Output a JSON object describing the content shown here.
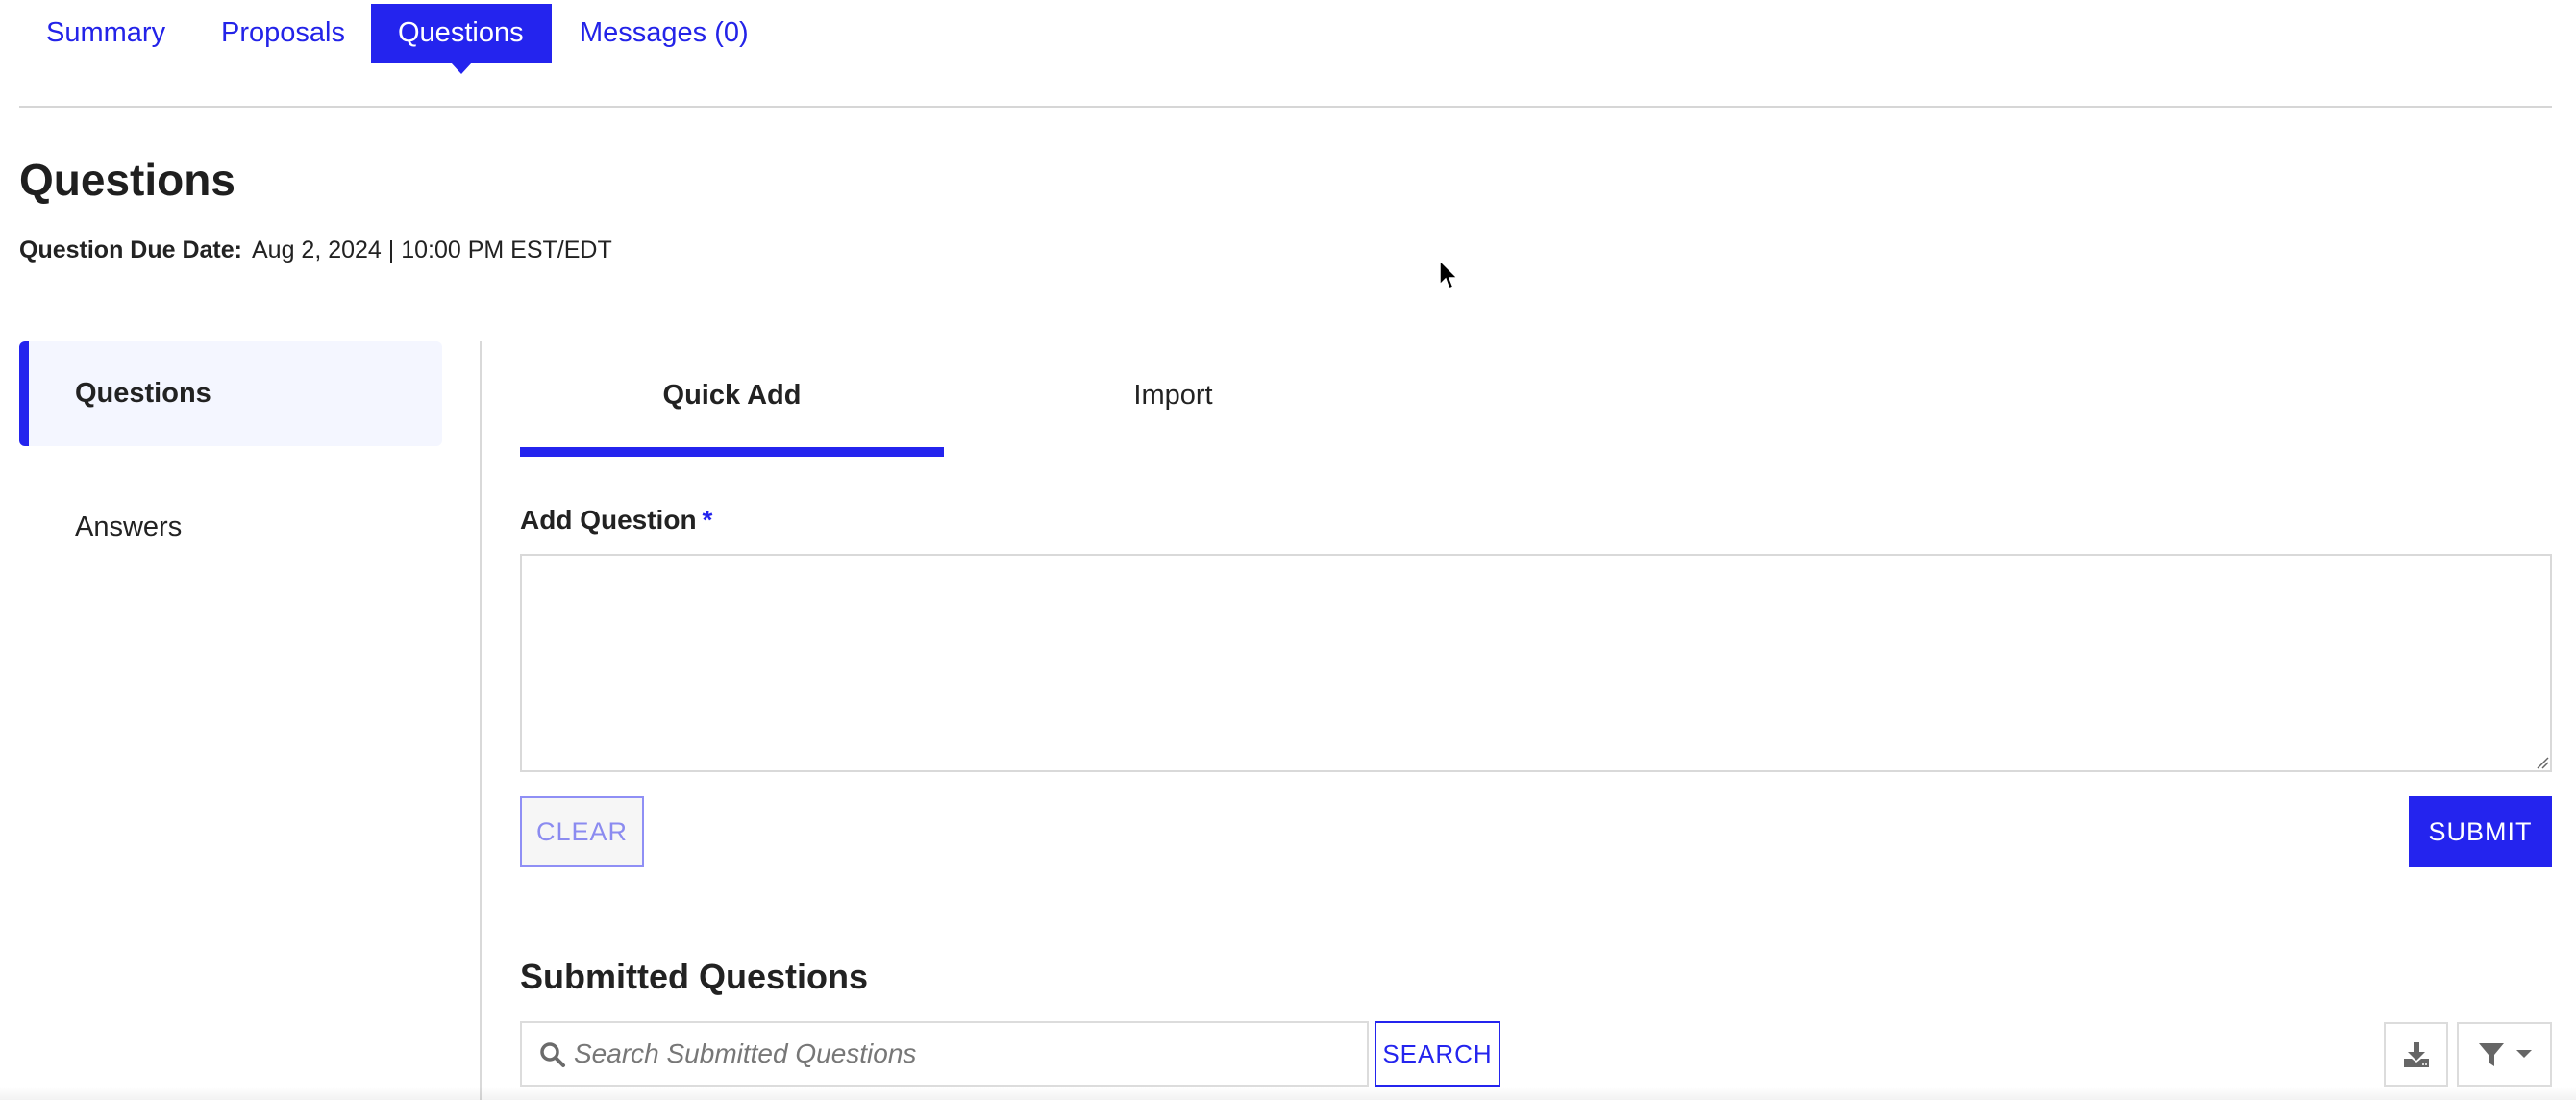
{
  "top_tabs": [
    {
      "label": "Summary",
      "active": false
    },
    {
      "label": "Proposals",
      "active": false
    },
    {
      "label": "Questions",
      "active": true
    },
    {
      "label": "Messages (0)",
      "active": false
    }
  ],
  "page": {
    "title": "Questions",
    "due_date_label": "Question Due Date:",
    "due_date_value": "Aug 2, 2024 | 10:00 PM EST/EDT"
  },
  "sidebar": {
    "items": [
      {
        "label": "Questions",
        "active": true
      },
      {
        "label": "Answers",
        "active": false
      }
    ]
  },
  "sub_tabs": [
    {
      "label": "Quick Add",
      "active": true
    },
    {
      "label": "Import",
      "active": false
    }
  ],
  "form": {
    "add_question_label": "Add Question",
    "required_marker": "*",
    "question_value": "",
    "clear_label": "CLEAR",
    "submit_label": "SUBMIT"
  },
  "submitted": {
    "title": "Submitted Questions",
    "search_placeholder": "Search Submitted Questions",
    "search_value": "",
    "search_button_label": "SEARCH",
    "download_icon": "download-icon",
    "filter_icon": "filter-icon"
  },
  "colors": {
    "accent": "#2424ee",
    "active_sidebar_bg": "#f4f6ff",
    "clear_button_text": "#8b8bf0",
    "border": "#d9d9d9"
  }
}
